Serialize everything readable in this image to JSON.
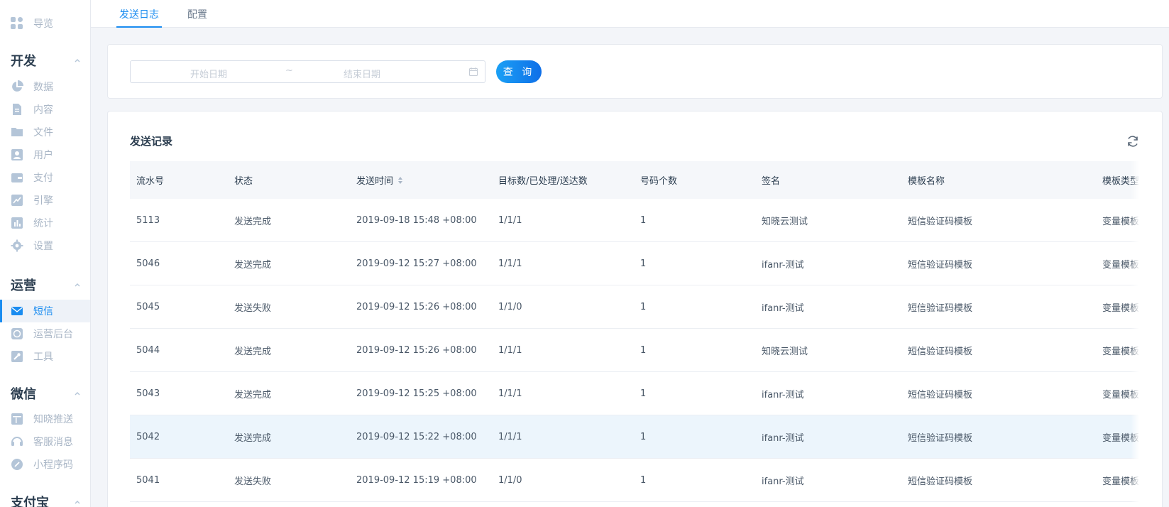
{
  "sidebar": {
    "overview": {
      "label": "导览",
      "icon": "grid-icon"
    },
    "sections": [
      {
        "title": "开发",
        "items": [
          {
            "label": "数据",
            "icon": "pie-chart-icon"
          },
          {
            "label": "内容",
            "icon": "document-icon"
          },
          {
            "label": "文件",
            "icon": "folder-icon"
          },
          {
            "label": "用户",
            "icon": "user-icon"
          },
          {
            "label": "支付",
            "icon": "wallet-icon"
          },
          {
            "label": "引擎",
            "icon": "trend-icon"
          },
          {
            "label": "统计",
            "icon": "bar-chart-icon"
          },
          {
            "label": "设置",
            "icon": "gear-icon"
          }
        ]
      },
      {
        "title": "运营",
        "items": [
          {
            "label": "短信",
            "icon": "mail-icon",
            "active": true
          },
          {
            "label": "运营后台",
            "icon": "console-icon"
          },
          {
            "label": "工具",
            "icon": "wrench-icon"
          }
        ]
      },
      {
        "title": "微信",
        "items": [
          {
            "label": "知晓推送",
            "icon": "layout-icon"
          },
          {
            "label": "客服消息",
            "icon": "headset-icon"
          },
          {
            "label": "小程序码",
            "icon": "link-icon"
          }
        ]
      },
      {
        "title": "支付宝",
        "items": []
      }
    ]
  },
  "tabs": [
    {
      "label": "发送日志",
      "active": true
    },
    {
      "label": "配置",
      "active": false
    }
  ],
  "filter": {
    "start_placeholder": "开始日期",
    "separator": "~",
    "end_placeholder": "结束日期",
    "query_label": "查 询"
  },
  "records": {
    "title": "发送记录",
    "columns": [
      "流水号",
      "状态",
      "发送时间",
      "目标数/已处理/送达数",
      "号码个数",
      "签名",
      "模板名称",
      "模板类型"
    ],
    "rows": [
      [
        "5113",
        "发送完成",
        "2019-09-18 15:48 +08:00",
        "1/1/1",
        "1",
        "知晓云测试",
        "短信验证码模板",
        "变量模板"
      ],
      [
        "5046",
        "发送完成",
        "2019-09-12 15:27 +08:00",
        "1/1/1",
        "1",
        "ifanr-测试",
        "短信验证码模板",
        "变量模板"
      ],
      [
        "5045",
        "发送失败",
        "2019-09-12 15:26 +08:00",
        "1/1/0",
        "1",
        "ifanr-测试",
        "短信验证码模板",
        "变量模板"
      ],
      [
        "5044",
        "发送完成",
        "2019-09-12 15:26 +08:00",
        "1/1/1",
        "1",
        "知晓云测试",
        "短信验证码模板",
        "变量模板"
      ],
      [
        "5043",
        "发送完成",
        "2019-09-12 15:25 +08:00",
        "1/1/1",
        "1",
        "ifanr-测试",
        "短信验证码模板",
        "变量模板"
      ],
      [
        "5042",
        "发送完成",
        "2019-09-12 15:22 +08:00",
        "1/1/1",
        "1",
        "ifanr-测试",
        "短信验证码模板",
        "变量模板"
      ],
      [
        "5041",
        "发送失败",
        "2019-09-12 15:19 +08:00",
        "1/1/0",
        "1",
        "ifanr-测试",
        "短信验证码模板",
        "变量模板"
      ]
    ],
    "highlighted_row": 5
  },
  "colors": {
    "accent": "#1a8cf0",
    "sidebar_text": "#a9b6c6",
    "highlight_row": "#ecf5fc"
  }
}
